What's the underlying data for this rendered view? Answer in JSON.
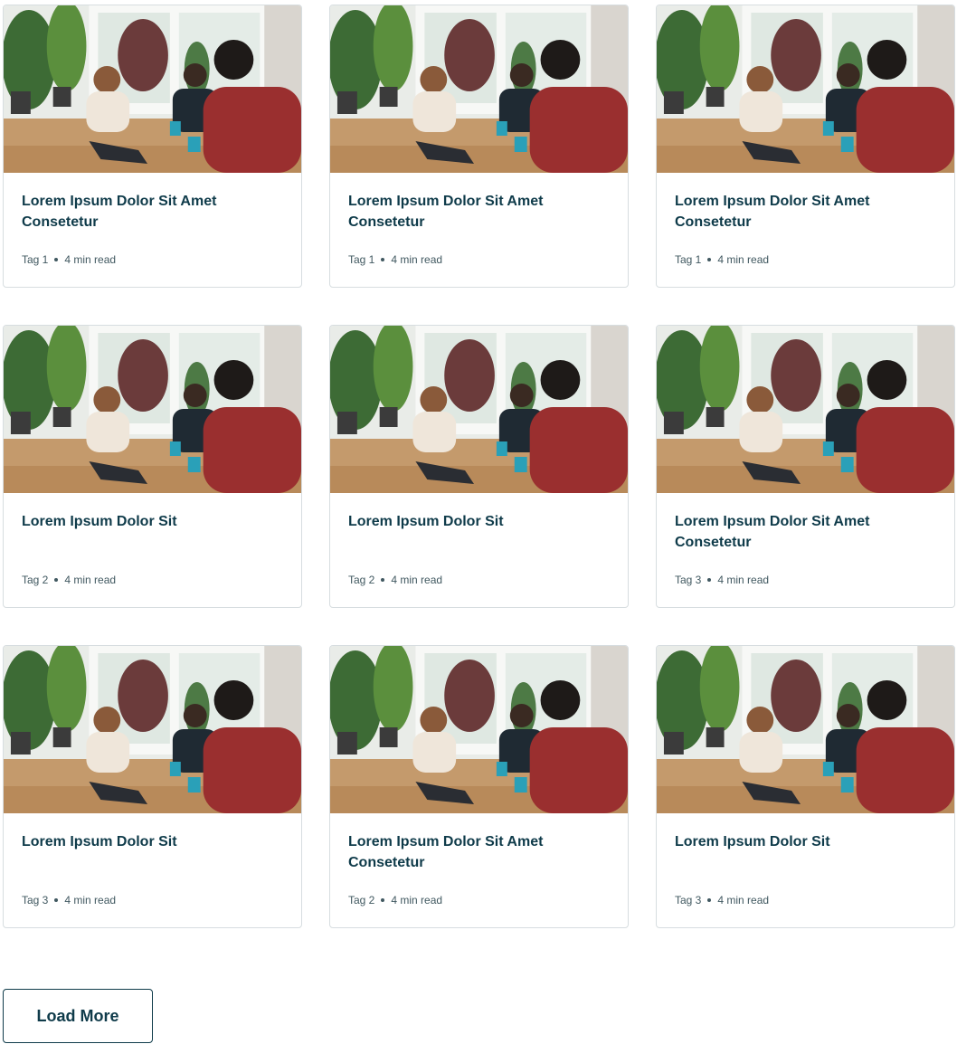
{
  "cards": [
    {
      "title": "Lorem Ipsum Dolor Sit Amet Consetetur",
      "tag": "Tag 1",
      "read_time": "4 min read",
      "image": "meeting-photo"
    },
    {
      "title": "Lorem Ipsum Dolor Sit Amet Consetetur",
      "tag": "Tag 1",
      "read_time": "4 min read",
      "image": "meeting-photo"
    },
    {
      "title": "Lorem Ipsum Dolor Sit Amet Consetetur",
      "tag": "Tag 1",
      "read_time": "4 min read",
      "image": "meeting-photo"
    },
    {
      "title": "Lorem Ipsum Dolor Sit",
      "tag": "Tag 2",
      "read_time": "4 min read",
      "image": "meeting-photo"
    },
    {
      "title": "Lorem Ipsum Dolor Sit",
      "tag": "Tag 2",
      "read_time": "4 min read",
      "image": "meeting-photo"
    },
    {
      "title": "Lorem Ipsum Dolor Sit Amet Consetetur",
      "tag": "Tag 3",
      "read_time": "4 min read",
      "image": "meeting-photo"
    },
    {
      "title": "Lorem Ipsum Dolor Sit",
      "tag": "Tag 3",
      "read_time": "4 min read",
      "image": "meeting-photo"
    },
    {
      "title": "Lorem Ipsum Dolor Sit Amet Consetetur",
      "tag": "Tag 2",
      "read_time": "4 min read",
      "image": "meeting-photo"
    },
    {
      "title": "Lorem Ipsum Dolor Sit",
      "tag": "Tag 3",
      "read_time": "4 min read",
      "image": "meeting-photo"
    }
  ],
  "load_more": {
    "label": "Load More"
  },
  "colors": {
    "heading": "#0f3b4a",
    "meta": "#405860",
    "border": "#d7dde0"
  }
}
